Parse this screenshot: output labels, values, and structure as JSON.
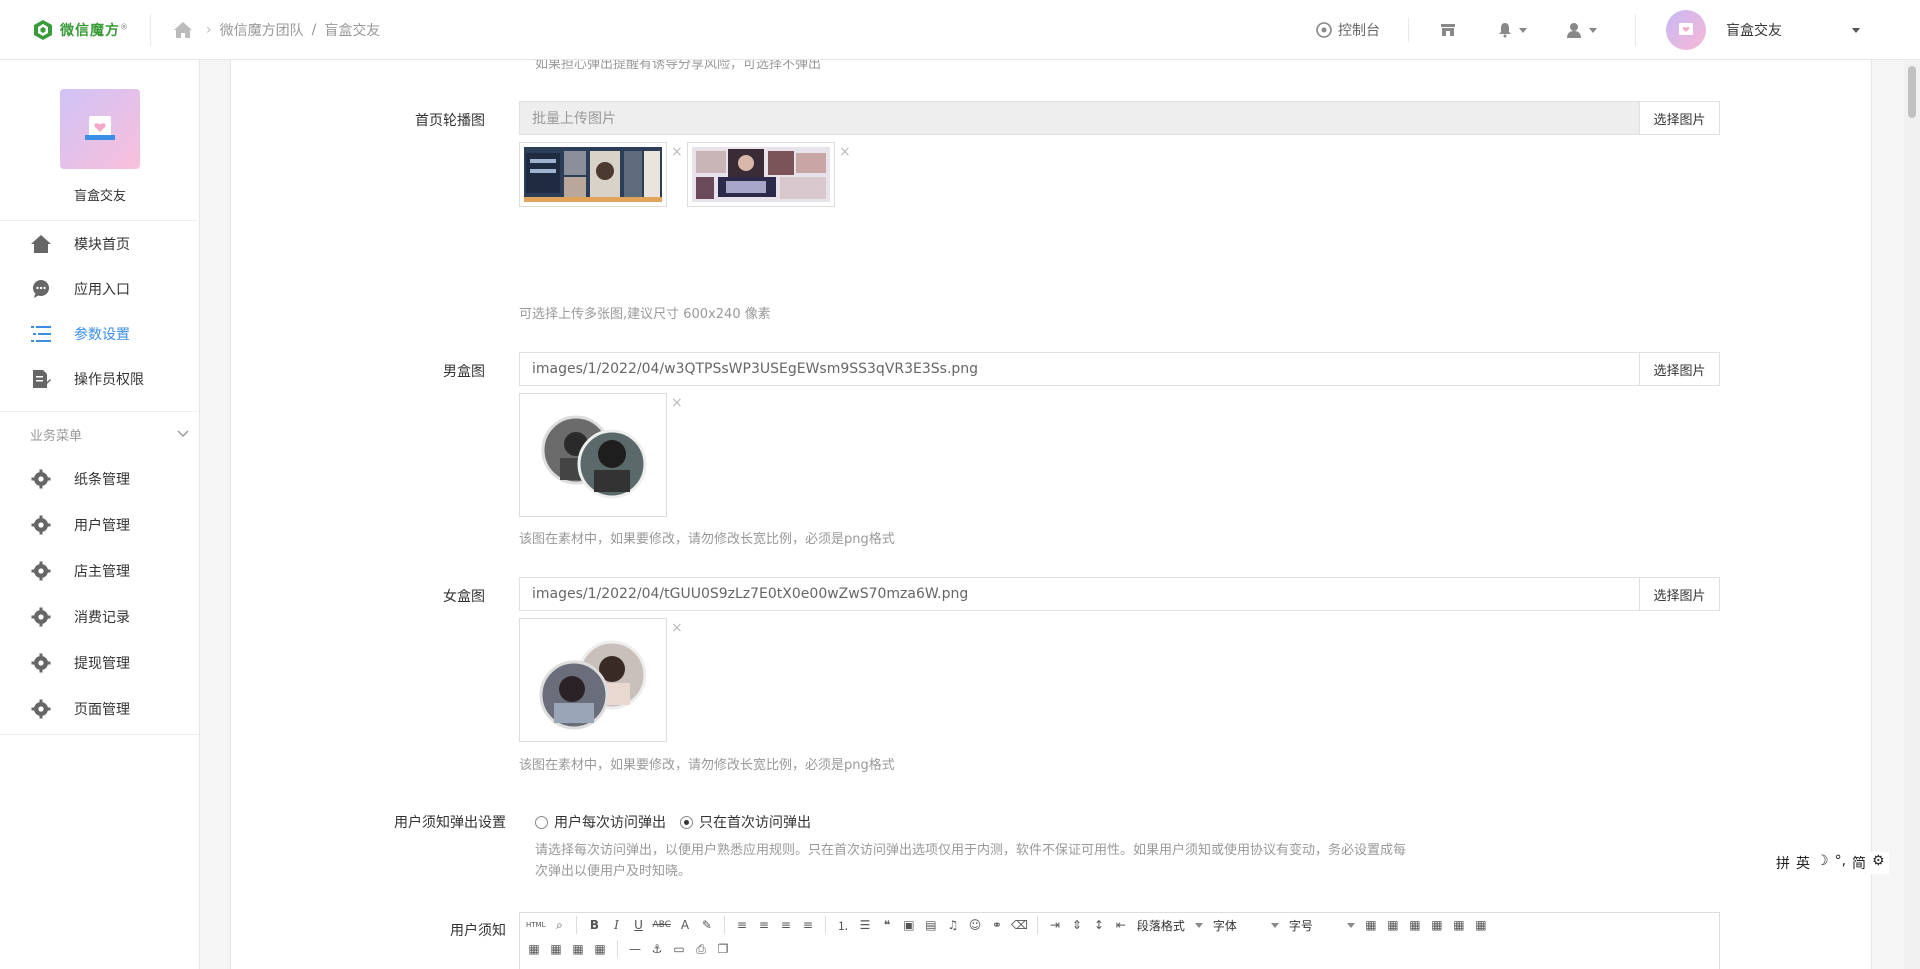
{
  "header": {
    "logo_text": "微信魔方",
    "logo_mark": "®",
    "breadcrumb_team": "微信魔方团队",
    "breadcrumb_sep": "/",
    "breadcrumb_app": "盲盒交友",
    "console_label": "控制台",
    "username": "盲盒交友"
  },
  "sidebar": {
    "app_name": "盲盒交友",
    "items": [
      {
        "label": "模块首页",
        "icon": "home-icon"
      },
      {
        "label": "应用入口",
        "icon": "chat-icon"
      },
      {
        "label": "参数设置",
        "icon": "list-icon",
        "active": true
      },
      {
        "label": "操作员权限",
        "icon": "edit-doc-icon"
      }
    ],
    "group_title": "业务菜单",
    "group_items": [
      {
        "label": "纸条管理",
        "icon": "gear-icon"
      },
      {
        "label": "用户管理",
        "icon": "gear-icon"
      },
      {
        "label": "店主管理",
        "icon": "gear-icon"
      },
      {
        "label": "消费记录",
        "icon": "gear-icon"
      },
      {
        "label": "提现管理",
        "icon": "gear-icon"
      },
      {
        "label": "页面管理",
        "icon": "gear-icon"
      }
    ]
  },
  "main": {
    "top_hint": "如果担心弹出提醒有诱导分享风险，可选择不弹出",
    "carousel": {
      "label": "首页轮播图",
      "placeholder": "批量上传图片",
      "button": "选择图片",
      "help": "可选择上传多张图,建议尺寸 600x240 像素"
    },
    "male_box": {
      "label": "男盒图",
      "value": "images/1/2022/04/w3QTPSsWP3USEgEWsm9SS3qVR3E3Ss.png",
      "button": "选择图片",
      "help": "该图在素材中，如果要修改，请勿修改长宽比例，必须是png格式"
    },
    "female_box": {
      "label": "女盒图",
      "value": "images/1/2022/04/tGUU0S9zLz7E0tX0e00wZwS70mza6W.png",
      "button": "选择图片",
      "help": "该图在素材中，如果要修改，请勿修改长宽比例，必须是png格式"
    },
    "notice_popup": {
      "label": "用户须知弹出设置",
      "option1": "用户每次访问弹出",
      "option2": "只在首次访问弹出",
      "selected": 2,
      "help": "请选择每次访问弹出，以便用户熟悉应用规则。只在首次访问弹出选项仅用于内测，软件不保证可用性。如果用户须知或使用协议有变动，务必设置成每次弹出以便用户及时知晓。"
    },
    "notice_editor": {
      "label": "用户须知",
      "html_btn": "HTML",
      "bold": "B",
      "italic": "I",
      "underline": "U",
      "strike": "ABC",
      "fontcolor": "A",
      "paragraph": "段落格式",
      "font": "字体",
      "size": "字号"
    },
    "close_glyph": "×"
  },
  "ime": [
    "拼",
    "英",
    "简"
  ]
}
